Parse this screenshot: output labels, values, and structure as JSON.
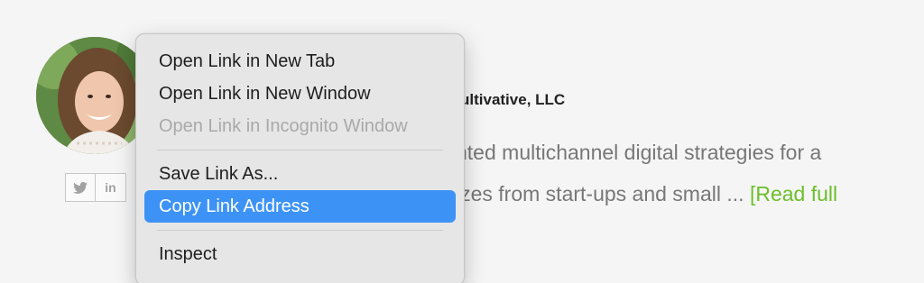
{
  "profile": {
    "company_fragment": "ultivative, LLC",
    "bio_line_1": "nted multichannel digital strategies for a",
    "bio_line_2": "izes from start-ups and small ... ",
    "read_more": "[Read full",
    "social": [
      {
        "icon": "twitter-icon",
        "glyph": "🐦"
      },
      {
        "icon": "linkedin-icon",
        "glyph": "in"
      }
    ]
  },
  "context_menu": {
    "items": [
      {
        "label": "Open Link in New Tab",
        "state": "enabled"
      },
      {
        "label": "Open Link in New Window",
        "state": "enabled"
      },
      {
        "label": "Open Link in Incognito Window",
        "state": "disabled"
      },
      {
        "label": "Save Link As...",
        "state": "enabled"
      },
      {
        "label": "Copy Link Address",
        "state": "selected"
      },
      {
        "label": "Inspect",
        "state": "enabled"
      }
    ]
  },
  "colors": {
    "page_bg": "#f5f5f5",
    "menu_bg": "#e6e6e6",
    "selection": "#3d93f5",
    "read_more": "#6cbf2a",
    "disabled_text": "#a9a9a9"
  }
}
